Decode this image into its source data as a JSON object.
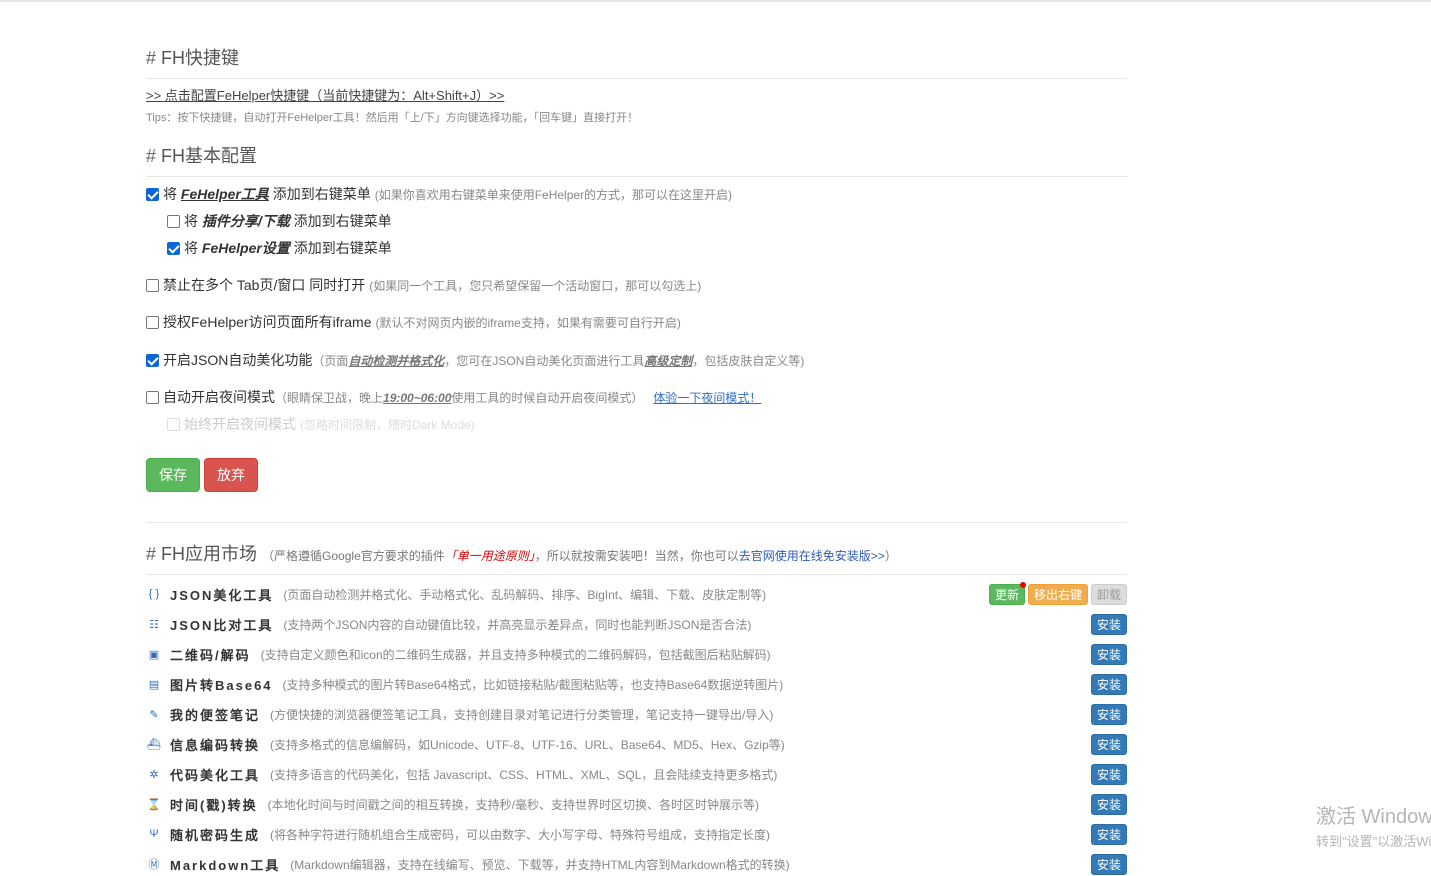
{
  "shortcut": {
    "title": "FH快捷键",
    "link": ">> 点击配置FeHelper快捷键（当前快捷键为：Alt+Shift+J）>>",
    "tips": "Tips：按下快捷键，自动打开FeHelper工具！然后用「上/下」方向键选择功能，「回车键」直接打开！"
  },
  "basic": {
    "title": "FH基本配置",
    "opt_menu": {
      "pre": "将",
      "em": "FeHelper工具",
      "post": "添加到右键菜单",
      "note": "(如果你喜欢用右键菜单来使用FeHelper的方式，那可以在这里开启)",
      "checked": true
    },
    "opt_share": {
      "pre": "将",
      "em": "插件分享/下载",
      "post": "添加到右键菜单",
      "checked": false
    },
    "opt_settings": {
      "pre": "将",
      "em": "FeHelper设置",
      "post": "添加到右键菜单",
      "checked": true
    },
    "opt_tabs": {
      "label": "禁止在多个 Tab页/窗口 同时打开",
      "note": "(如果同一个工具，您只希望保留一个活动窗口，那可以勾选上)",
      "checked": false
    },
    "opt_iframe": {
      "label": "授权FeHelper访问页面所有iframe",
      "note": "(默认不对网页内嵌的iframe支持，如果有需要可自行开启)",
      "checked": false
    },
    "opt_json": {
      "label": "开启JSON自动美化功能",
      "note_a": "（页面",
      "note_em1": "自动检测并格式化",
      "note_b": "，您可在JSON自动美化页面进行工具",
      "note_em2": "高级定制",
      "note_c": "，包括皮肤自定义等)",
      "checked": true
    },
    "opt_night": {
      "label": "自动开启夜间模式",
      "note_a": "（眼睛保卫战，晚上",
      "note_time": "19:00~06:00",
      "note_b": "使用工具的时候自动开启夜间模式）",
      "link": "体验一下夜间模式！",
      "checked": false
    },
    "opt_always_night": {
      "label": "始终开启夜间模式",
      "note": "(忽略时间限制，随时Dark Mode)",
      "checked": false
    },
    "save_label": "保存",
    "cancel_label": "放弃"
  },
  "market": {
    "title": "FH应用市场",
    "note_a": "（严格遵循Google官方要求的插件",
    "note_red": "「单一用途原则」",
    "note_b": "，所以就按需安装吧！当然，你也可以",
    "note_link": "去官网使用在线免安装版>>",
    "note_c": "）",
    "tools": [
      {
        "icon": "{ }",
        "icon_name": "json-icon",
        "name": "JSON美化工具",
        "desc": "(页面自动检测并格式化、手动格式化、乱码解码、排序、BigInt、编辑、下载、皮肤定制等)",
        "installed": true,
        "update_label": "更新",
        "remove_menu_label": "移出右键",
        "uninstall_label": "卸载"
      },
      {
        "icon": "☷",
        "icon_name": "compare-icon",
        "name": "JSON比对工具",
        "desc": "(支持两个JSON内容的自动键值比较，并高亮显示差异点，同时也能判断JSON是否合法)",
        "installed": false,
        "install_label": "安装"
      },
      {
        "icon": "▣",
        "icon_name": "qrcode-icon",
        "name": "二维码/解码",
        "desc": "(支持自定义颜色和icon的二维码生成器，并且支持多种模式的二维码解码，包括截图后粘贴解码)",
        "installed": false,
        "install_label": "安装"
      },
      {
        "icon": "▤",
        "icon_name": "image-icon",
        "name": "图片转Base64",
        "desc": "(支持多种模式的图片转Base64格式，比如链接粘贴/截图粘贴等，也支持Base64数据逆转图片)",
        "installed": false,
        "install_label": "安装"
      },
      {
        "icon": "✎",
        "icon_name": "pencil-icon",
        "name": "我的便签笔记",
        "desc": "(方便快捷的浏览器便签笔记工具，支持创建目录对笔记进行分类管理，笔记支持一键导出/导入)",
        "installed": false,
        "install_label": "安装"
      },
      {
        "icon": "⛴",
        "icon_name": "ship-icon",
        "name": "信息编码转换",
        "desc": "(支持多格式的信息编解码，如Unicode、UTF-8、UTF-16、URL、Base64、MD5、Hex、Gzip等)",
        "installed": false,
        "install_label": "安装"
      },
      {
        "icon": "✲",
        "icon_name": "gear-icon",
        "name": "代码美化工具",
        "desc": "(支持多语言的代码美化，包括 Javascript、CSS、HTML、XML、SQL，且会陆续支持更多格式)",
        "installed": false,
        "install_label": "安装"
      },
      {
        "icon": "⌛",
        "icon_name": "hourglass-icon",
        "name": "时间(戳)转换",
        "desc": "(本地化时间与时间戳之间的相互转换，支持秒/毫秒、支持世界时区切换、各时区时钟展示等)",
        "installed": false,
        "install_label": "安装"
      },
      {
        "icon": "Ψ",
        "icon_name": "trident-icon",
        "name": "随机密码生成",
        "desc": "(将各种字符进行随机组合生成密码，可以由数字、大小写字母、特殊符号组成，支持指定长度)",
        "installed": false,
        "install_label": "安装"
      },
      {
        "icon": "Ⓜ",
        "icon_name": "markdown-icon",
        "name": "Markdown工具",
        "desc": "(Markdown编辑器，支持在线编写、预览、下载等，并支持HTML内容到Markdown格式的转换)",
        "installed": false,
        "install_label": "安装"
      }
    ]
  },
  "watermark": {
    "line1": "激活 Windows",
    "line2": "转到\"设置\"以激活Windows。"
  }
}
